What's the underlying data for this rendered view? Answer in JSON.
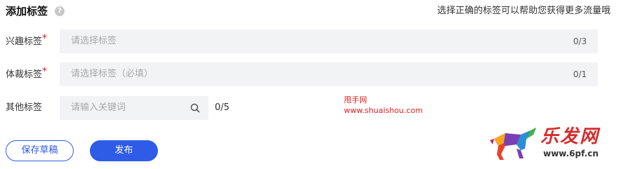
{
  "header": {
    "title": "添加标签",
    "help_icon": "question-circle-icon",
    "hint": "选择正确的标签可以帮助您获得更多流量哦"
  },
  "fields": {
    "interest": {
      "label": "兴趣标签",
      "required_mark": "*",
      "placeholder": "请选择标签",
      "count": "0/3"
    },
    "genre": {
      "label": "体裁标签",
      "required_mark": "*",
      "placeholder": "请选择标签（必填）",
      "count": "0/1"
    },
    "other": {
      "label": "其他标签",
      "placeholder": "请输入关键词",
      "search_icon": "search-icon",
      "count": "0/5"
    }
  },
  "watermark": {
    "name": "甩手网",
    "url": "www.shuaishou.com"
  },
  "buttons": {
    "save_draft": "保存草稿",
    "publish": "发布"
  },
  "logo": {
    "text": "乐发网",
    "url": "www.6pf.cn"
  },
  "colors": {
    "accent": "#2e5ce6",
    "required": "#e02020",
    "field_bg": "#f2f3f5"
  }
}
